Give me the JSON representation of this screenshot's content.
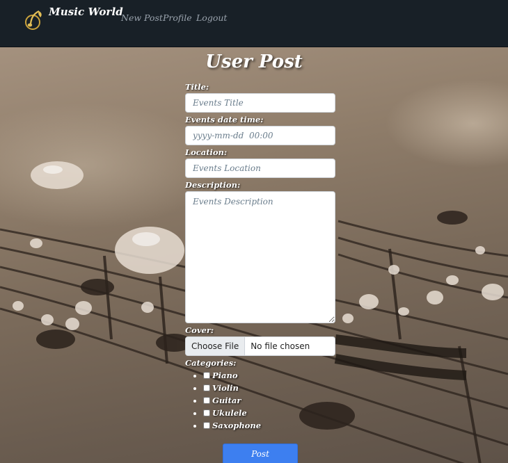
{
  "navbar": {
    "brand": "Music World",
    "logo_icon": "music-note-logo-icon",
    "links": [
      {
        "label": "New Post"
      },
      {
        "label": "Profile"
      },
      {
        "label": "Logout"
      }
    ]
  },
  "page": {
    "title": "User Post"
  },
  "form": {
    "title_label": "Title:",
    "title_placeholder": "Events Title",
    "datetime_label": "Events date time:",
    "datetime_placeholder": "yyyy-mm-dd  00:00",
    "location_label": "Location:",
    "location_placeholder": "Events Location",
    "description_label": "Description:",
    "description_placeholder": "Events Description",
    "cover_label": "Cover:",
    "choose_file_label": "Choose File",
    "file_status": "No file chosen",
    "categories_label": "Categories:",
    "categories": [
      {
        "label": "Piano",
        "checked": false
      },
      {
        "label": "Violin",
        "checked": false
      },
      {
        "label": "Guitar",
        "checked": false
      },
      {
        "label": "Ukulele",
        "checked": false
      },
      {
        "label": "Saxophone",
        "checked": false
      }
    ],
    "submit_label": "Post"
  },
  "colors": {
    "navbar_bg": "#182027",
    "nav_link": "#9aa3ad",
    "button_primary": "#3d7ff0"
  }
}
